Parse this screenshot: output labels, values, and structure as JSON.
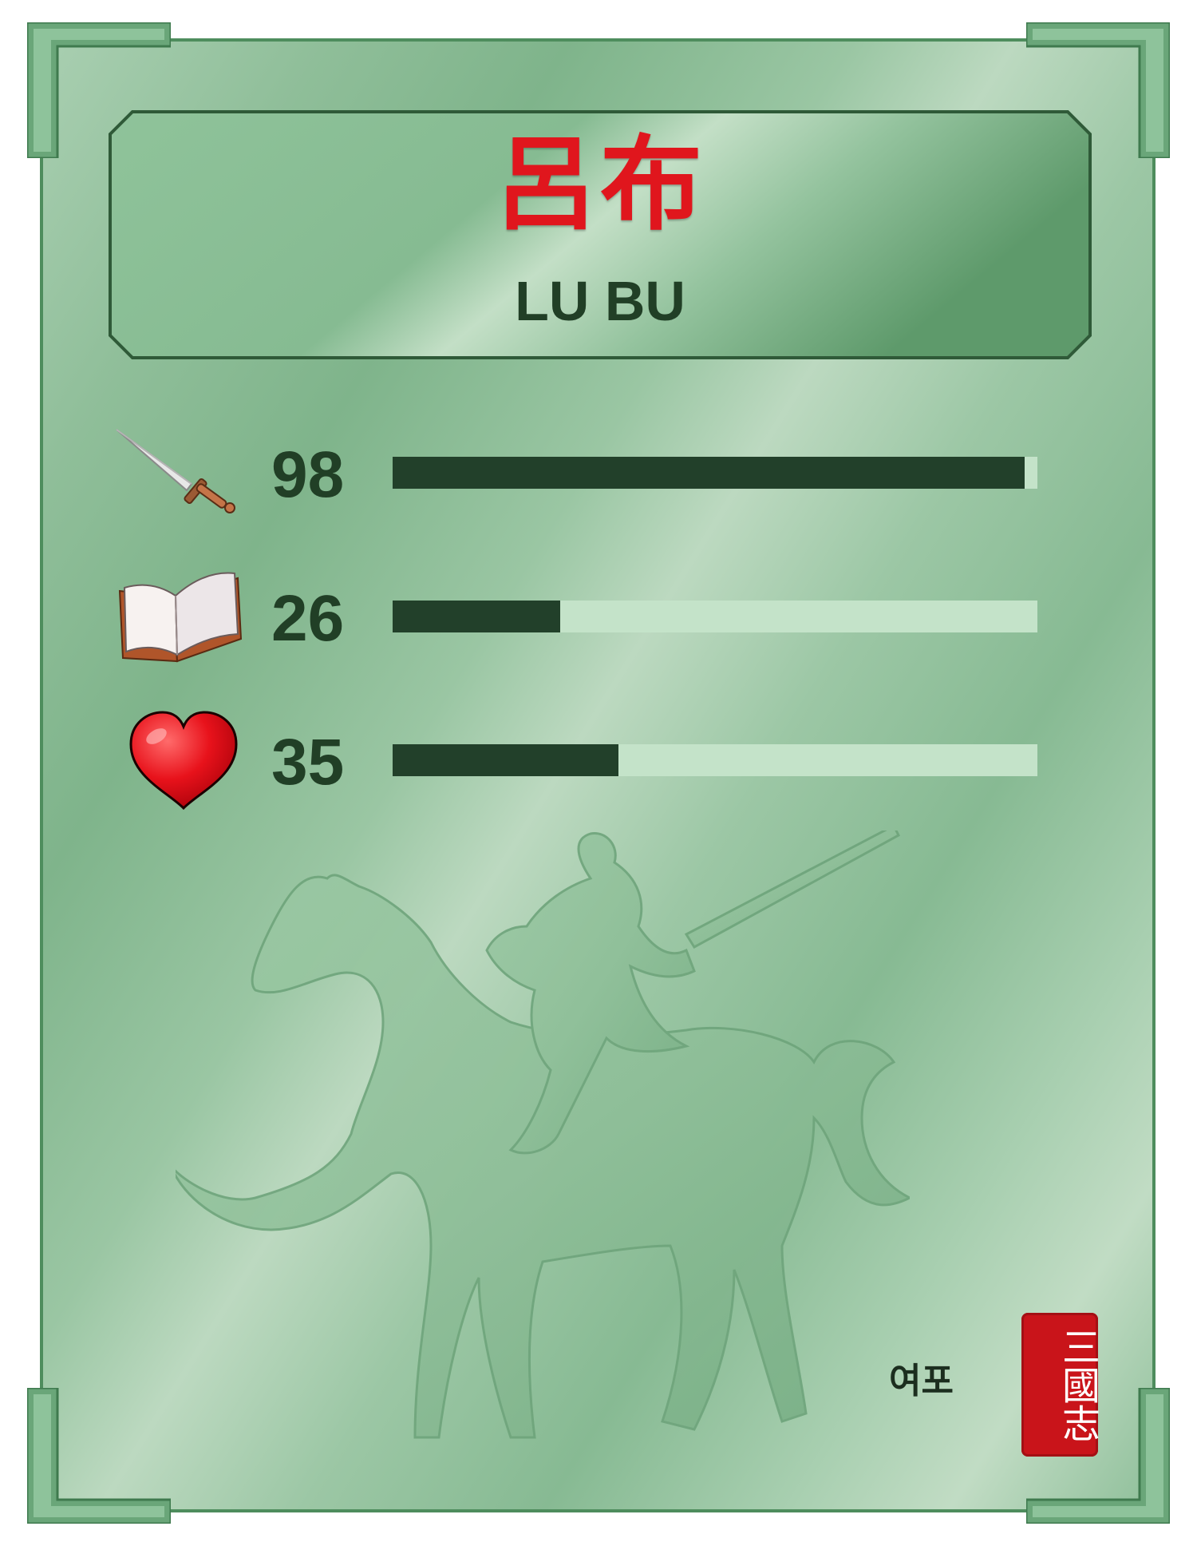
{
  "card": {
    "name_zh": "呂布",
    "name_en": "LU BU",
    "name_ko": "여포",
    "seal_text": "三國志"
  },
  "stats": [
    {
      "icon": "sword-icon",
      "value": "98",
      "fraction": 0.98
    },
    {
      "icon": "book-icon",
      "value": "26",
      "fraction": 0.26
    },
    {
      "icon": "heart-icon",
      "value": "35",
      "fraction": 0.35
    }
  ],
  "colors": {
    "card_green": "#8fbe99",
    "border_green": "#4e8d5d",
    "title_red": "#e0161d",
    "text_dark_green": "#213f26",
    "bar_fill": "#22402a",
    "bar_track": "#c4e3c9",
    "seal_red": "#c9141a"
  }
}
